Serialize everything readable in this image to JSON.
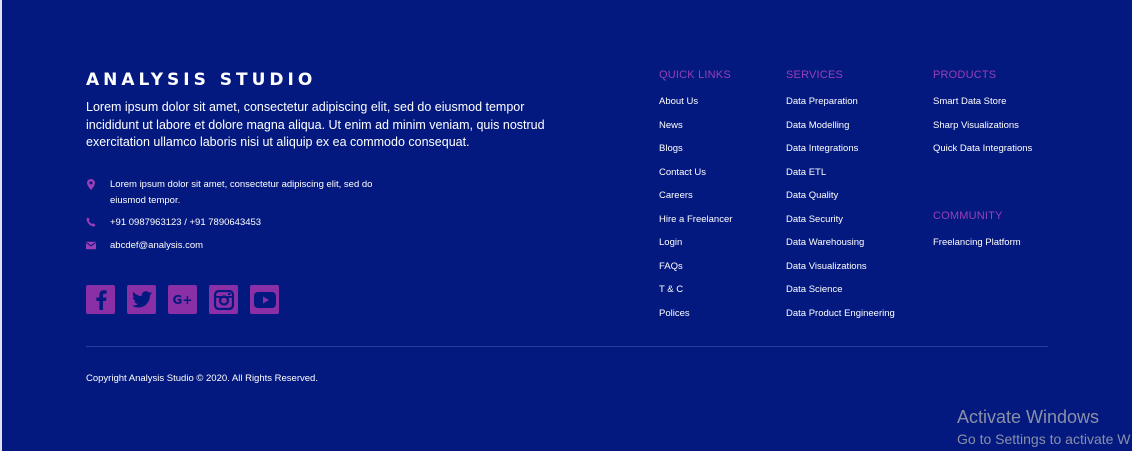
{
  "brand": {
    "title": "ANALYSIS STUDIO",
    "description": "Lorem ipsum dolor sit amet, consectetur adipiscing elit, sed do eiusmod tempor incididunt ut labore et dolore magna aliqua. Ut enim ad minim veniam, quis nostrud exercitation ullamco laboris nisi ut aliquip ex ea commodo consequat."
  },
  "contact": {
    "address": "Lorem ipsum dolor sit amet, consectetur adipiscing elit, sed do eiusmod tempor.",
    "phone": "+91 0987963123 / +91 7890643453",
    "email": "abcdef@analysis.com"
  },
  "socials": {
    "icons": [
      "facebook-icon",
      "twitter-icon",
      "google-plus-icon",
      "instagram-icon",
      "youtube-icon"
    ],
    "google_label": "G+"
  },
  "quick_links": {
    "heading": "QUICK LINKS",
    "items": [
      "About Us",
      "News",
      "Blogs",
      "Contact Us",
      "Careers",
      "Hire a Freelancer",
      "Login",
      "FAQs",
      "T & C",
      "Polices"
    ]
  },
  "services": {
    "heading": "SERVICES",
    "items": [
      "Data Preparation",
      "Data Modelling",
      "Data Integrations",
      "Data ETL",
      "Data Quality",
      "Data Security",
      "Data Warehousing",
      "Data Visualizations",
      "Data Science",
      "Data Product Engineering"
    ]
  },
  "products": {
    "heading": "PRODUCTS",
    "items": [
      "Smart Data Store",
      "Sharp Visualizations",
      "Quick Data Integrations"
    ]
  },
  "community": {
    "heading": "COMMUNITY",
    "items": [
      "Freelancing Platform"
    ]
  },
  "copyright": "Copyright Analysis Studio © 2020. All Rights Reserved.",
  "watermark": {
    "title": "Activate Windows",
    "subtitle": "Go to Settings to activate W"
  },
  "colors": {
    "background": "#03197f",
    "accent": "#8a2fa6",
    "heading": "#9a3fb8"
  }
}
